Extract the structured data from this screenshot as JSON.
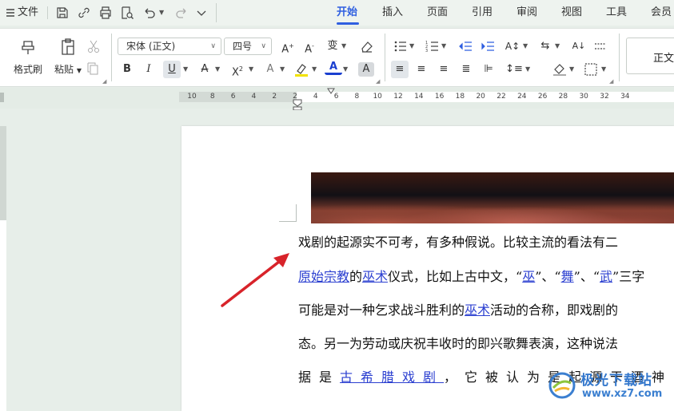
{
  "menubar": {
    "file_label": "文件",
    "tabs": [
      {
        "label": "开始",
        "active": true
      },
      {
        "label": "插入",
        "active": false
      },
      {
        "label": "页面",
        "active": false
      },
      {
        "label": "引用",
        "active": false
      },
      {
        "label": "审阅",
        "active": false
      },
      {
        "label": "视图",
        "active": false
      },
      {
        "label": "工具",
        "active": false
      },
      {
        "label": "会员专享",
        "active": false
      }
    ]
  },
  "ribbon": {
    "format_painter_label": "格式刷",
    "paste_label": "粘贴",
    "font_name": "宋体 (正文)",
    "font_size": "四号",
    "style_normal": "正文",
    "accent_color": "#2f5fe0",
    "highlight_color": "#f2e200",
    "font_color": "#1a3fd0"
  },
  "ruler": {
    "labels": [
      "10",
      "8",
      "6",
      "4",
      "2",
      "2",
      "4",
      "6",
      "8",
      "10",
      "12",
      "14",
      "16",
      "18",
      "20",
      "22",
      "24",
      "26",
      "28",
      "30",
      "32",
      "34"
    ]
  },
  "document": {
    "line1": "戏剧的起源实不可考，有多种假说。比较主流的看法有二",
    "line2": {
      "l1": "原始宗教",
      "t1": "的",
      "l2": "巫术",
      "t2": "仪式，比如上古中文，“",
      "l3": "巫",
      "t3": "”、“",
      "l4": "舞",
      "t4": "”、“",
      "l5": "武",
      "t5": "”三字"
    },
    "line3": {
      "t1": "可能是对一种乞求战斗胜利的",
      "l1": "巫术",
      "t2": "活动的合称，即戏剧的"
    },
    "line4": "态。另一为劳动或庆祝丰收时的即兴歌舞表演，这种说法",
    "line5": {
      "t1": "据是",
      "l1": "古希腊戏剧",
      "t2": "，它被认为是起源于酒神"
    }
  },
  "watermark": {
    "title": "极光下载站",
    "url": "www.xz7.com"
  }
}
